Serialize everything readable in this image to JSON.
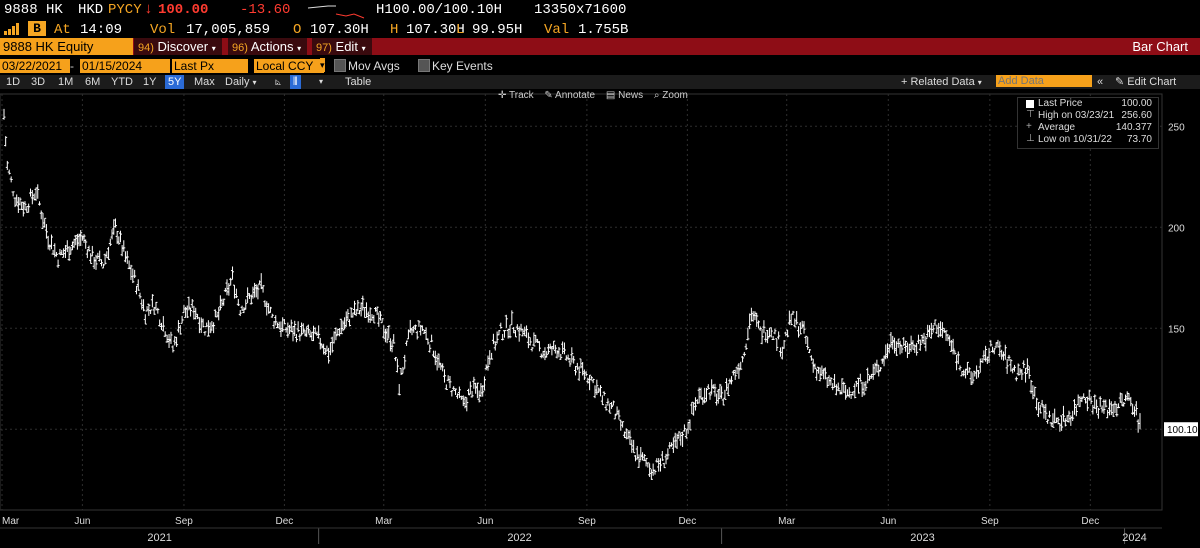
{
  "header": {
    "ticker": "9888 HK",
    "currency": "HKD",
    "exchange": "PYCY",
    "arrow": "↓",
    "last": "100.00",
    "change": "-13.60",
    "bid_ask": "H100.00/100.10H",
    "size": "13350x71600",
    "time_label": "At",
    "time": "14:09",
    "vol_label": "Vol",
    "volume": "17,005,859",
    "open_label": "O",
    "open": "107.30H",
    "high_label": "H",
    "high": "107.30H",
    "low_label": "L",
    "low": "99.95H",
    "val_label": "Val",
    "value": "1.755B",
    "signal_icon": "signal-bars-icon",
    "bb_icon": "bloomberg-b-icon"
  },
  "menubar": {
    "security": "9888 HK Equity",
    "discover_num": "94)",
    "discover": "Discover",
    "actions_num": "96)",
    "actions": "Actions",
    "edit_num": "97)",
    "edit": "Edit",
    "title": "Bar Chart"
  },
  "params": {
    "start_date": "03/22/2021",
    "end_date": "01/15/2024",
    "field": "Last Px",
    "currency": "Local CCY",
    "mov_avgs": "Mov Avgs",
    "key_events": "Key Events"
  },
  "toolbar": {
    "ranges": [
      "1D",
      "3D",
      "1M",
      "6M",
      "YTD",
      "1Y",
      "5Y",
      "Max"
    ],
    "selected_range": "5Y",
    "frequency": "Daily",
    "table": "Table",
    "related_data": "Related Data",
    "add_data_placeholder": "Add Data",
    "edit_chart": "Edit Chart"
  },
  "subtools": {
    "track": "Track",
    "annotate": "Annotate",
    "news": "News",
    "zoom": "Zoom"
  },
  "legend": {
    "last_price_label": "Last Price",
    "last_price": "100.00",
    "high_label": "High on 03/23/21",
    "high": "256.60",
    "average_label": "Average",
    "average": "140.377",
    "low_label": "Low on 10/31/22",
    "low": "73.70"
  },
  "chart_data": {
    "type": "bar",
    "title": "",
    "xlabel": "",
    "ylabel": "",
    "ylim": [
      60,
      266
    ],
    "yticks": [
      100,
      150,
      200,
      250
    ],
    "price_tag": "100.10",
    "month_ticks": [
      "Mar",
      "Jun",
      "Sep",
      "Dec",
      "Mar",
      "Jun",
      "Sep",
      "Dec",
      "Mar",
      "Jun",
      "Sep",
      "Dec"
    ],
    "year_labels": [
      "2021",
      "2022",
      "2023",
      "2024"
    ],
    "x_start": "2021-03-22",
    "x_end": "2024-01-15",
    "grid": true,
    "colors": {
      "bars": "#ffffff",
      "grid": "#2e2e2e",
      "background": "#000000"
    },
    "series": [
      {
        "values": [
          [
            "2021-03-22",
            256
          ],
          [
            "2021-03-25",
            230
          ],
          [
            "2021-04-01",
            215
          ],
          [
            "2021-04-10",
            210
          ],
          [
            "2021-04-20",
            218
          ],
          [
            "2021-05-01",
            195
          ],
          [
            "2021-05-10",
            185
          ],
          [
            "2021-05-20",
            190
          ],
          [
            "2021-06-01",
            195
          ],
          [
            "2021-06-10",
            185
          ],
          [
            "2021-06-20",
            182
          ],
          [
            "2021-07-01",
            200
          ],
          [
            "2021-07-10",
            185
          ],
          [
            "2021-07-20",
            172
          ],
          [
            "2021-07-28",
            158
          ],
          [
            "2021-08-05",
            162
          ],
          [
            "2021-08-15",
            150
          ],
          [
            "2021-08-22",
            140
          ],
          [
            "2021-09-01",
            158
          ],
          [
            "2021-09-10",
            160
          ],
          [
            "2021-09-20",
            150
          ],
          [
            "2021-10-01",
            155
          ],
          [
            "2021-10-10",
            168
          ],
          [
            "2021-10-15",
            175
          ],
          [
            "2021-10-22",
            160
          ],
          [
            "2021-11-01",
            166
          ],
          [
            "2021-11-10",
            170
          ],
          [
            "2021-11-20",
            155
          ],
          [
            "2021-12-01",
            150
          ],
          [
            "2021-12-15",
            148
          ],
          [
            "2022-01-01",
            145
          ],
          [
            "2022-01-10",
            138
          ],
          [
            "2022-01-20",
            150
          ],
          [
            "2022-02-01",
            157
          ],
          [
            "2022-02-10",
            160
          ],
          [
            "2022-02-20",
            158
          ],
          [
            "2022-03-01",
            150
          ],
          [
            "2022-03-10",
            142
          ],
          [
            "2022-03-15",
            122
          ],
          [
            "2022-03-25",
            148
          ],
          [
            "2022-04-05",
            150
          ],
          [
            "2022-04-15",
            140
          ],
          [
            "2022-04-25",
            125
          ],
          [
            "2022-05-05",
            118
          ],
          [
            "2022-05-12",
            112
          ],
          [
            "2022-05-20",
            120
          ],
          [
            "2022-05-28",
            118
          ],
          [
            "2022-06-05",
            138
          ],
          [
            "2022-06-15",
            148
          ],
          [
            "2022-06-25",
            152
          ],
          [
            "2022-07-05",
            148
          ],
          [
            "2022-07-15",
            142
          ],
          [
            "2022-07-25",
            138
          ],
          [
            "2022-08-05",
            140
          ],
          [
            "2022-08-15",
            135
          ],
          [
            "2022-08-25",
            130
          ],
          [
            "2022-09-05",
            125
          ],
          [
            "2022-09-15",
            115
          ],
          [
            "2022-09-25",
            110
          ],
          [
            "2022-10-05",
            98
          ],
          [
            "2022-10-15",
            88
          ],
          [
            "2022-10-31",
            80
          ],
          [
            "2022-11-10",
            85
          ],
          [
            "2022-11-20",
            92
          ],
          [
            "2022-11-30",
            100
          ],
          [
            "2022-12-10",
            115
          ],
          [
            "2022-12-20",
            120
          ],
          [
            "2023-01-01",
            115
          ],
          [
            "2023-01-10",
            125
          ],
          [
            "2023-01-20",
            135
          ],
          [
            "2023-01-28",
            158
          ],
          [
            "2023-02-05",
            148
          ],
          [
            "2023-02-15",
            150
          ],
          [
            "2023-02-25",
            140
          ],
          [
            "2023-03-05",
            155
          ],
          [
            "2023-03-15",
            150
          ],
          [
            "2023-03-25",
            132
          ],
          [
            "2023-04-05",
            125
          ],
          [
            "2023-04-15",
            120
          ],
          [
            "2023-04-25",
            118
          ],
          [
            "2023-05-05",
            122
          ],
          [
            "2023-05-15",
            125
          ],
          [
            "2023-05-25",
            132
          ],
          [
            "2023-06-05",
            145
          ],
          [
            "2023-06-15",
            140
          ],
          [
            "2023-06-25",
            142
          ],
          [
            "2023-07-05",
            145
          ],
          [
            "2023-07-15",
            152
          ],
          [
            "2023-07-25",
            145
          ],
          [
            "2023-08-05",
            132
          ],
          [
            "2023-08-15",
            125
          ],
          [
            "2023-08-25",
            132
          ],
          [
            "2023-09-05",
            142
          ],
          [
            "2023-09-15",
            135
          ],
          [
            "2023-09-25",
            128
          ],
          [
            "2023-10-05",
            130
          ],
          [
            "2023-10-15",
            112
          ],
          [
            "2023-10-25",
            105
          ],
          [
            "2023-11-05",
            104
          ],
          [
            "2023-11-15",
            108
          ],
          [
            "2023-11-25",
            118
          ],
          [
            "2023-12-05",
            112
          ],
          [
            "2023-12-15",
            110
          ],
          [
            "2023-12-25",
            112
          ],
          [
            "2024-01-05",
            115
          ],
          [
            "2024-01-10",
            112
          ],
          [
            "2024-01-15",
            100
          ]
        ]
      }
    ]
  }
}
